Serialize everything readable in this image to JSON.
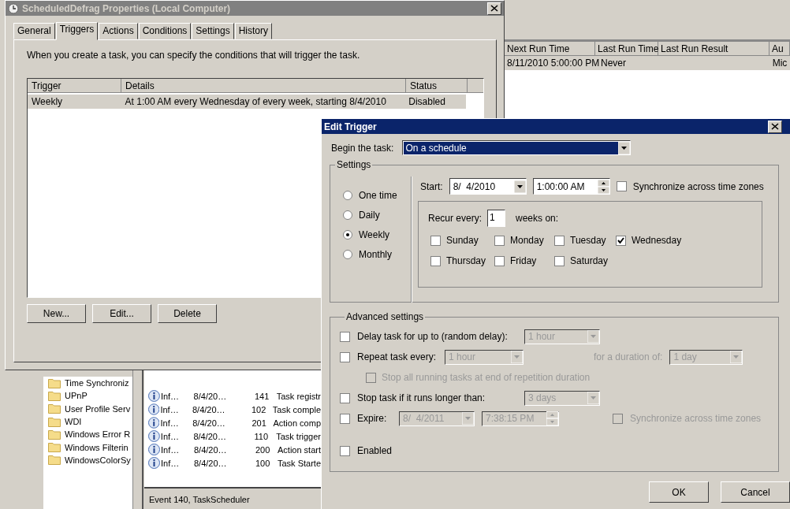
{
  "background_window": {
    "task_table": {
      "columns": [
        "Next Run Time",
        "Last Run Time",
        "Last Run Result",
        "Au"
      ],
      "rows": [
        {
          "next_run_time": "8/11/2010 5:00:00 PM",
          "last_run_time": "Never",
          "column_4": "Mic",
          "selected": true
        }
      ]
    },
    "tree_items": [
      "Time Synchroniz",
      "UPnP",
      "User Profile Serv",
      "WDI",
      "Windows Error R",
      "Windows Filterin",
      "WindowsColorSy"
    ],
    "events": [
      {
        "severity": "Inf…",
        "date": "8/4/20…",
        "event_id": "141",
        "task_category": "Task registr"
      },
      {
        "severity": "Inf…",
        "date": "8/4/20…",
        "event_id": "102",
        "task_category": "Task comple"
      },
      {
        "severity": "Inf…",
        "date": "8/4/20…",
        "event_id": "201",
        "task_category": "Action comp"
      },
      {
        "severity": "Inf…",
        "date": "8/4/20…",
        "event_id": "110",
        "task_category": "Task trigger"
      },
      {
        "severity": "Inf…",
        "date": "8/4/20…",
        "event_id": "200",
        "task_category": "Action start"
      },
      {
        "severity": "Inf…",
        "date": "8/4/20…",
        "event_id": "100",
        "task_category": "Task Starte"
      }
    ],
    "status_bar": "Event 140, TaskScheduler"
  },
  "properties_dialog": {
    "title": "ScheduledDefrag Properties (Local Computer)",
    "tabs": [
      {
        "label": "General",
        "selected": false
      },
      {
        "label": "Triggers",
        "selected": true
      },
      {
        "label": "Actions",
        "selected": false
      },
      {
        "label": "Conditions",
        "selected": false
      },
      {
        "label": "Settings",
        "selected": false
      },
      {
        "label": "History",
        "selected": false
      }
    ],
    "description": "When you create a task, you can specify the conditions that will trigger the task.",
    "triggers": {
      "columns": [
        "Trigger",
        "Details",
        "Status"
      ],
      "rows": [
        {
          "trigger": "Weekly",
          "details": "At 1:00 AM every Wednesday of every week, starting 8/4/2010",
          "status": "Disabled",
          "selected": true
        }
      ]
    },
    "buttons": [
      "New...",
      "Edit...",
      "Delete"
    ]
  },
  "edit_trigger": {
    "title": "Edit Trigger",
    "begin_label": "Begin the task:",
    "begin_value": "On a schedule",
    "settings_label": "Settings",
    "schedule_options": [
      {
        "label": "One time",
        "selected": false
      },
      {
        "label": "Daily",
        "selected": false
      },
      {
        "label": "Weekly",
        "selected": true
      },
      {
        "label": "Monthly",
        "selected": false
      }
    ],
    "start_label": "Start:",
    "start_date": "8/  4/2010",
    "start_time": "1:00:00 AM",
    "sync": {
      "label": "Synchronize across time zones",
      "checked": false
    },
    "recur_label": "Recur every:",
    "recur_value": "1",
    "recur_unit": "weeks on:",
    "days": [
      {
        "label": "Sunday",
        "checked": false
      },
      {
        "label": "Monday",
        "checked": false
      },
      {
        "label": "Tuesday",
        "checked": false
      },
      {
        "label": "Wednesday",
        "checked": true
      },
      {
        "label": "Thursday",
        "checked": false
      },
      {
        "label": "Friday",
        "checked": false
      },
      {
        "label": "Saturday",
        "checked": false
      }
    ],
    "advanced_label": "Advanced settings",
    "delay": {
      "label": "Delay task for up to (random delay):",
      "checked": false,
      "value": "1 hour",
      "disabled": true
    },
    "repeat": {
      "label": "Repeat task every:",
      "checked": false,
      "value": "1 hour",
      "duration_label": "for a duration of:",
      "duration_value": "1 day",
      "disabled": true
    },
    "stop_all": {
      "label": "Stop all running tasks at end of repetition duration",
      "checked": false,
      "disabled": true
    },
    "stop_task": {
      "label": "Stop task if it runs longer than:",
      "checked": false,
      "value": "3 days",
      "disabled": true
    },
    "expire": {
      "label": "Expire:",
      "checked": false,
      "date": "8/  4/2011",
      "time": "7:38:15 PM",
      "disabled": true,
      "sync_label": "Synchronize across time zones",
      "sync_checked": false
    },
    "enabled": {
      "label": "Enabled",
      "checked": false
    },
    "buttons": [
      "OK",
      "Cancel"
    ]
  }
}
